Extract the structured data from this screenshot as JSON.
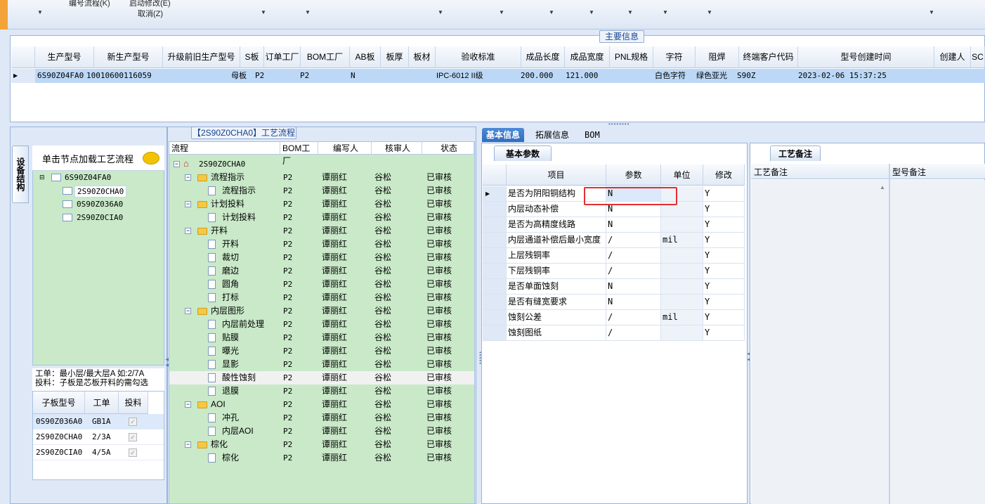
{
  "toolbar": {
    "top_labels": [
      "编号流程(K)",
      "启动修改(E)"
    ],
    "cancel_label": "取消(Z)"
  },
  "main_info": {
    "title": "主要信息",
    "columns": [
      "生产型号",
      "新生产型号",
      "升级前旧生产型号",
      "S板",
      "订单工厂",
      "BOM工厂",
      "AB板",
      "板厚",
      "板材",
      "验收标准",
      "成品长度",
      "成品宽度",
      "PNL规格",
      "字符",
      "阻焊",
      "终端客户代码",
      "型号创建时间",
      "创建人",
      "SC"
    ],
    "row": [
      "6S90Z04FA0",
      "10010600116059",
      "",
      "母板",
      "P2",
      "P2",
      "N",
      "",
      "",
      "IPC-6012 II级",
      "200.000",
      "121.000",
      "",
      "白色字符",
      "绿色亚光",
      "S90Z",
      "2023-02-06 15:37:25",
      "",
      ""
    ]
  },
  "left": {
    "vtab": "设备结构",
    "tree_header": "单击节点加载工艺流程",
    "tree": {
      "root": "6S90Z04FA0",
      "children": [
        "2S90Z0CHA0",
        "0S90Z036A0",
        "2S90Z0CIA0"
      ]
    },
    "note_line1": "工单：最小层/最大层A 如:2/7A",
    "note_line2": "投料：子板是芯板开料的需勾选",
    "sub_columns": [
      "子板型号",
      "工单",
      "投料"
    ],
    "sub_rows": [
      {
        "model": "0S90Z036A0",
        "order": "GB1A"
      },
      {
        "model": "2S90Z0CHA0",
        "order": "2/3A"
      },
      {
        "model": "2S90Z0CIA0",
        "order": "4/5A"
      }
    ]
  },
  "process": {
    "title": "【2S90Z0CHA0】工艺流程",
    "columns": [
      "流程",
      "BOM工厂",
      "编写人",
      "核审人",
      "状态"
    ],
    "root": "2S90Z0CHA0",
    "rows": [
      {
        "name": "流程指示",
        "level": 1,
        "factory": "P2",
        "writer": "谭丽红",
        "reviewer": "谷松",
        "status": "已审核"
      },
      {
        "name": "流程指示",
        "level": 2,
        "factory": "P2",
        "writer": "谭丽红",
        "reviewer": "谷松",
        "status": "已审核"
      },
      {
        "name": "计划投料",
        "level": 1,
        "factory": "P2",
        "writer": "谭丽红",
        "reviewer": "谷松",
        "status": "已审核"
      },
      {
        "name": "计划投料",
        "level": 2,
        "factory": "P2",
        "writer": "谭丽红",
        "reviewer": "谷松",
        "status": "已审核"
      },
      {
        "name": "开料",
        "level": 1,
        "factory": "P2",
        "writer": "谭丽红",
        "reviewer": "谷松",
        "status": "已审核"
      },
      {
        "name": "开料",
        "level": 2,
        "factory": "P2",
        "writer": "谭丽红",
        "reviewer": "谷松",
        "status": "已审核"
      },
      {
        "name": "裁切",
        "level": 2,
        "factory": "P2",
        "writer": "谭丽红",
        "reviewer": "谷松",
        "status": "已审核"
      },
      {
        "name": "磨边",
        "level": 2,
        "factory": "P2",
        "writer": "谭丽红",
        "reviewer": "谷松",
        "status": "已审核"
      },
      {
        "name": "圆角",
        "level": 2,
        "factory": "P2",
        "writer": "谭丽红",
        "reviewer": "谷松",
        "status": "已审核"
      },
      {
        "name": "打标",
        "level": 2,
        "factory": "P2",
        "writer": "谭丽红",
        "reviewer": "谷松",
        "status": "已审核"
      },
      {
        "name": "内层图形",
        "level": 1,
        "factory": "P2",
        "writer": "谭丽红",
        "reviewer": "谷松",
        "status": "已审核"
      },
      {
        "name": "内层前处理",
        "level": 2,
        "factory": "P2",
        "writer": "谭丽红",
        "reviewer": "谷松",
        "status": "已审核"
      },
      {
        "name": "贴膜",
        "level": 2,
        "factory": "P2",
        "writer": "谭丽红",
        "reviewer": "谷松",
        "status": "已审核"
      },
      {
        "name": "曝光",
        "level": 2,
        "factory": "P2",
        "writer": "谭丽红",
        "reviewer": "谷松",
        "status": "已审核"
      },
      {
        "name": "显影",
        "level": 2,
        "factory": "P2",
        "writer": "谭丽红",
        "reviewer": "谷松",
        "status": "已审核"
      },
      {
        "name": "酸性蚀刻",
        "level": 2,
        "factory": "P2",
        "writer": "谭丽红",
        "reviewer": "谷松",
        "status": "已审核",
        "selected": true
      },
      {
        "name": "退膜",
        "level": 2,
        "factory": "P2",
        "writer": "谭丽红",
        "reviewer": "谷松",
        "status": "已审核"
      },
      {
        "name": "AOI",
        "level": 1,
        "factory": "P2",
        "writer": "谭丽红",
        "reviewer": "谷松",
        "status": "已审核"
      },
      {
        "name": "冲孔",
        "level": 2,
        "factory": "P2",
        "writer": "谭丽红",
        "reviewer": "谷松",
        "status": "已审核"
      },
      {
        "name": "内层AOI",
        "level": 2,
        "factory": "P2",
        "writer": "谭丽红",
        "reviewer": "谷松",
        "status": "已审核"
      },
      {
        "name": "棕化",
        "level": 1,
        "factory": "P2",
        "writer": "谭丽红",
        "reviewer": "谷松",
        "status": "已审核"
      },
      {
        "name": "棕化",
        "level": 2,
        "factory": "P2",
        "writer": "谭丽红",
        "reviewer": "谷松",
        "status": "已审核"
      }
    ]
  },
  "right": {
    "tabs": [
      "基本信息",
      "拓展信息",
      "BOM"
    ],
    "basic_params_tab": "基本参数",
    "param_columns": [
      "项目",
      "参数",
      "单位",
      "修改"
    ],
    "params": [
      {
        "item": "是否为阴阳铜结构",
        "value": "N",
        "unit": "",
        "modify": "Y"
      },
      {
        "item": "内层动态补偿",
        "value": "N",
        "unit": "",
        "modify": "Y"
      },
      {
        "item": "是否为高精度线路",
        "value": "N",
        "unit": "",
        "modify": "Y"
      },
      {
        "item": "内层通道补偿后最小宽度",
        "value": "/",
        "unit": "mil",
        "modify": "Y"
      },
      {
        "item": "上层残铜率",
        "value": "/",
        "unit": "",
        "modify": "Y"
      },
      {
        "item": "下层残铜率",
        "value": "/",
        "unit": "",
        "modify": "Y"
      },
      {
        "item": "是否单面蚀刻",
        "value": "N",
        "unit": "",
        "modify": "Y"
      },
      {
        "item": "是否有缝宽要求",
        "value": "N",
        "unit": "",
        "modify": "Y"
      },
      {
        "item": "蚀刻公差",
        "value": "/",
        "unit": "mil",
        "modify": "Y"
      },
      {
        "item": "蚀刻图纸",
        "value": "/",
        "unit": "",
        "modify": "Y"
      }
    ],
    "remark_tab": "工艺备注",
    "remark_columns": [
      "工艺备注",
      "型号备注"
    ]
  }
}
